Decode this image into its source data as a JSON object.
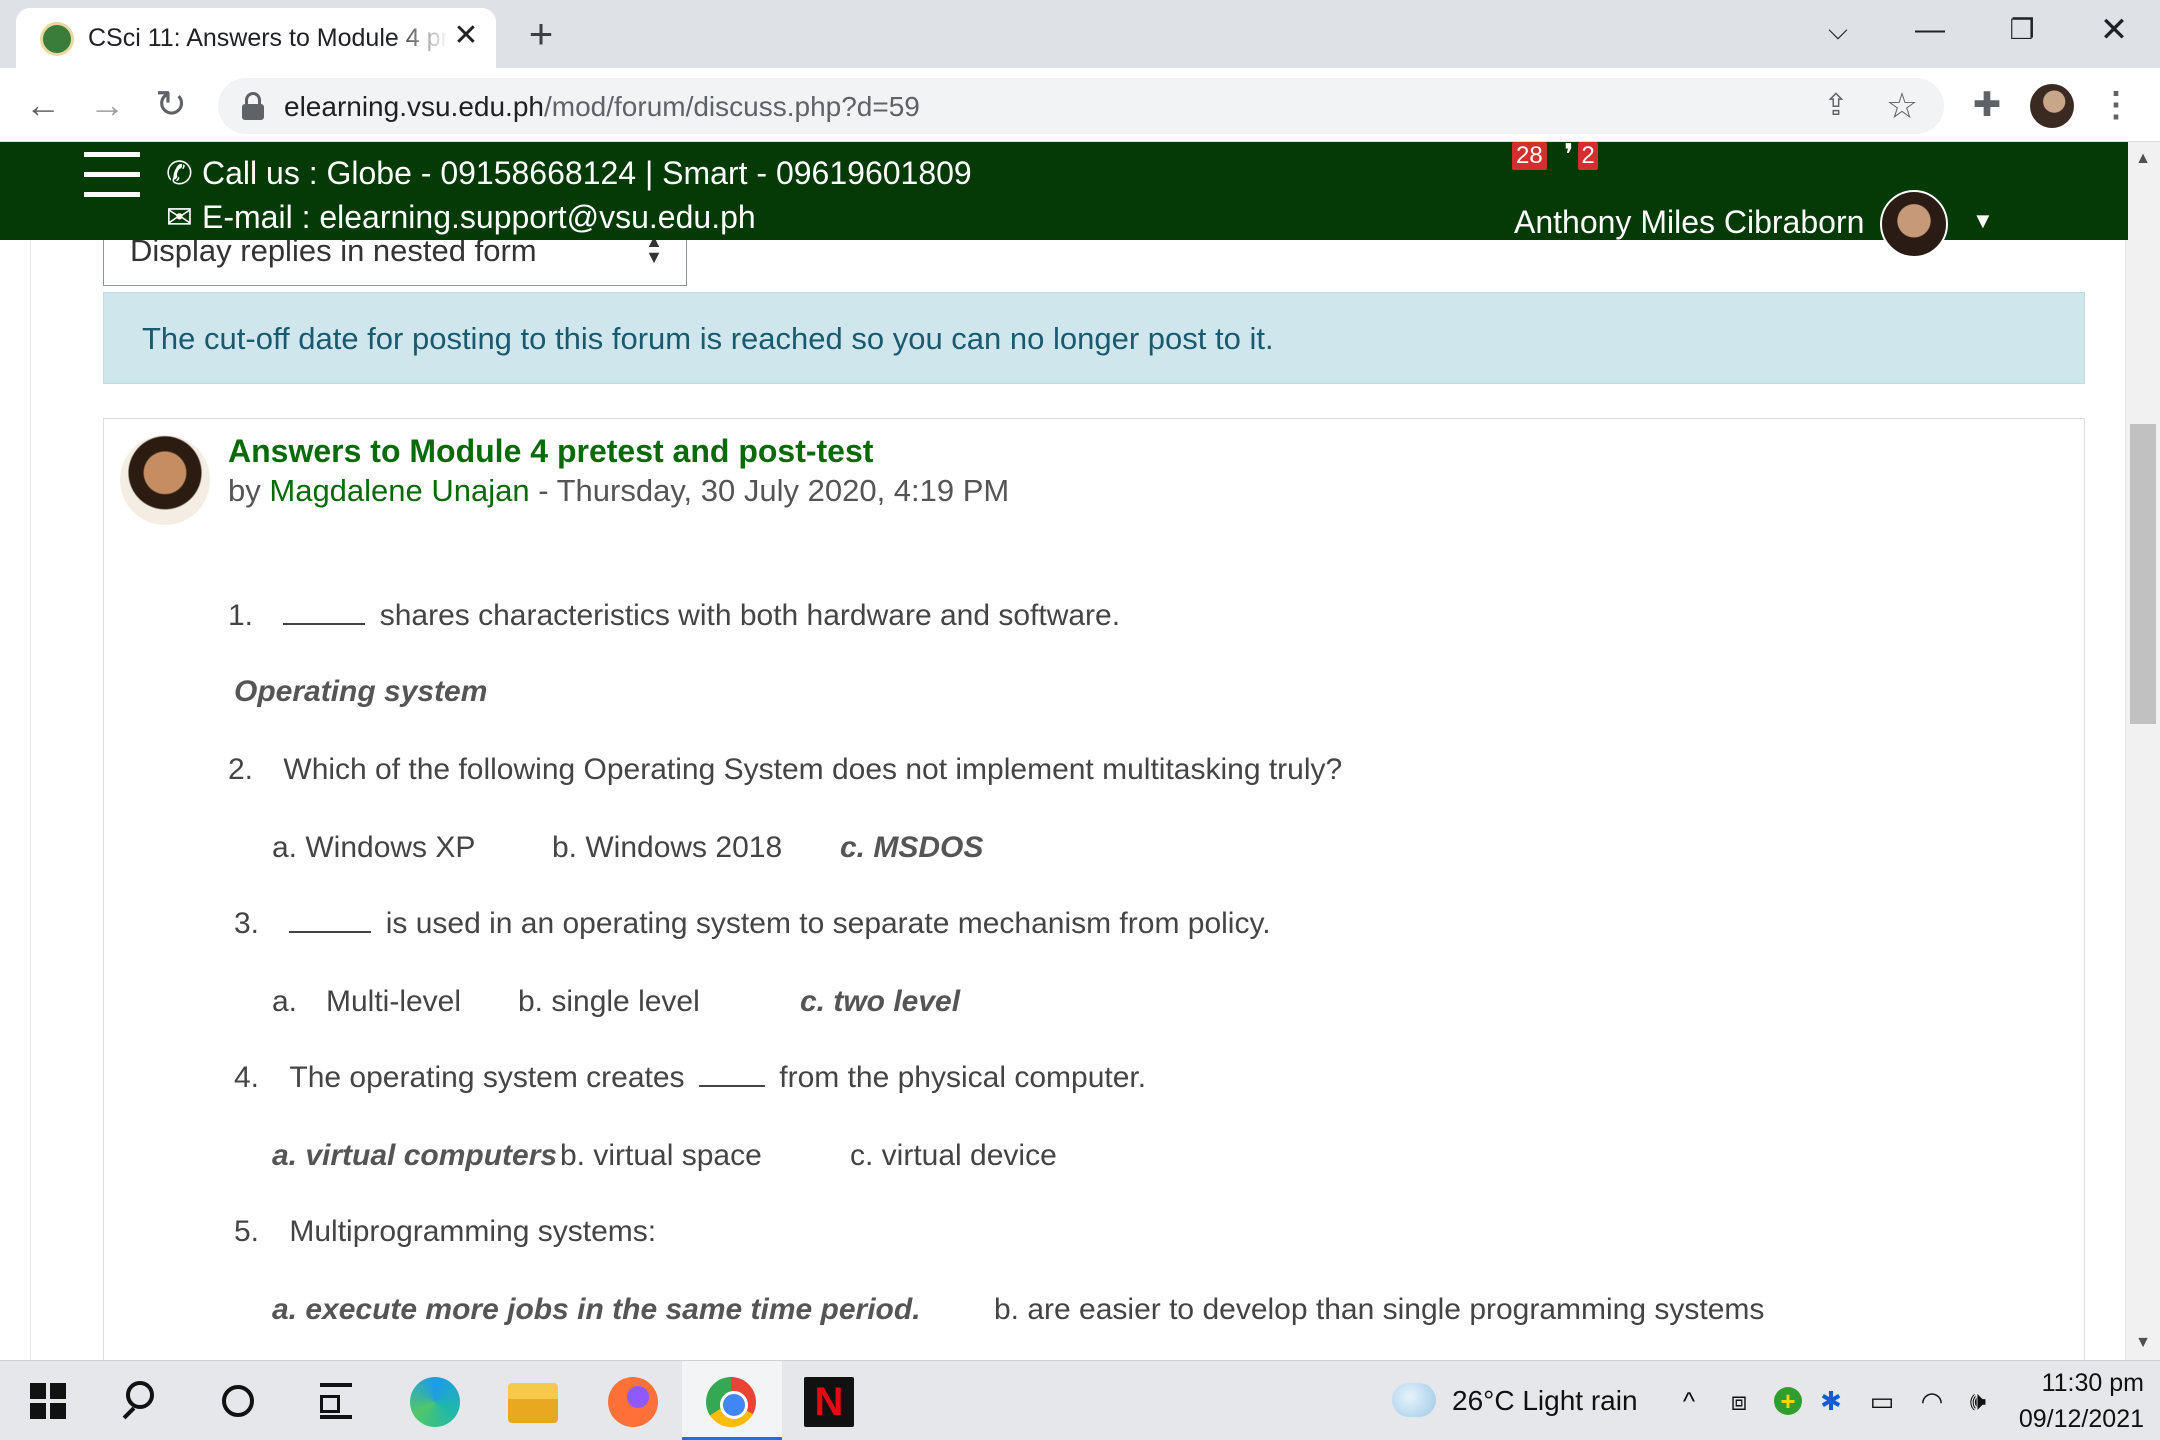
{
  "browser": {
    "tab_title": "CSci 11: Answers to Module 4 pretest and post-test",
    "tab_close": "✕",
    "new_tab": "+",
    "tab_search": "⌵",
    "minimize": "—",
    "restore": "❐",
    "close": "✕",
    "back": "←",
    "forward": "→",
    "reload": "↻",
    "url_host": "elearning.vsu.edu.ph",
    "url_path": "/mod/forum/discuss.php?d=59",
    "share_icon": "⇪",
    "star_icon": "☆",
    "extensions_icon": "✚",
    "menu_icon": "⋮"
  },
  "site_header": {
    "call_label": "Call us : Globe - 09158668124 | Smart - 09619601809",
    "email_label": "E-mail : elearning.support@vsu.edu.ph",
    "notification_count": "28",
    "message_count": "2",
    "user_name": "Anthony Miles Cibraborn"
  },
  "discussion": {
    "display_mode": "Display replies in nested form",
    "cutoff_notice": "The cut-off date for posting to this forum is reached so you can no longer post to it."
  },
  "post": {
    "subject": "Answers to Module 4 pretest and post-test",
    "by": "by",
    "author": "Magdalene Unajan",
    "date_sep": " - ",
    "date": "Thursday, 30 July 2020, 4:19 PM",
    "q1": {
      "num": "1.",
      "text": "shares characteristics with both hardware and software.",
      "answer": "Operating system"
    },
    "q2": {
      "num": "2.",
      "text": "Which of the following Operating System does not implement multitasking truly?",
      "opt_a": "a. Windows XP",
      "opt_b": "b. Windows 2018",
      "opt_c": "c. MSDOS"
    },
    "q3": {
      "num": "3.",
      "text": "is used in an operating system to separate mechanism from policy.",
      "opt_a_letter": "a.",
      "opt_a": "Multi-level",
      "opt_b": "b. single level",
      "opt_c": "c. two level"
    },
    "q4": {
      "num": "4.",
      "text_before": "The operating system creates",
      "text_after": "from the physical computer.",
      "opt_a": "a. virtual computers",
      "opt_b": "b. virtual space",
      "opt_c": "c. virtual device"
    },
    "q5": {
      "num": "5.",
      "text": "Multiprogramming systems:",
      "opt_a": "a. execute more jobs in the same time period.",
      "opt_b": "b. are easier to develop than single programming systems"
    }
  },
  "taskbar": {
    "apps": [
      "start",
      "search",
      "cortana",
      "task-view",
      "edge",
      "file-explorer",
      "firefox",
      "chrome",
      "netflix"
    ],
    "active_app": "chrome",
    "weather": "26°C  Light rain",
    "time": "11:30 pm",
    "date": "09/12/2021",
    "tray_chevron": "^",
    "tray_meet": "⧈",
    "tray_bluetooth": "✱",
    "tray_battery": "▭",
    "tray_wifi": "◠",
    "tray_volume": "🕪"
  },
  "colors": {
    "header_green": "#033a05",
    "link_green": "#0a6a0a",
    "notice_bg": "#cfe6ec",
    "badge_red": "#d32f2f"
  }
}
